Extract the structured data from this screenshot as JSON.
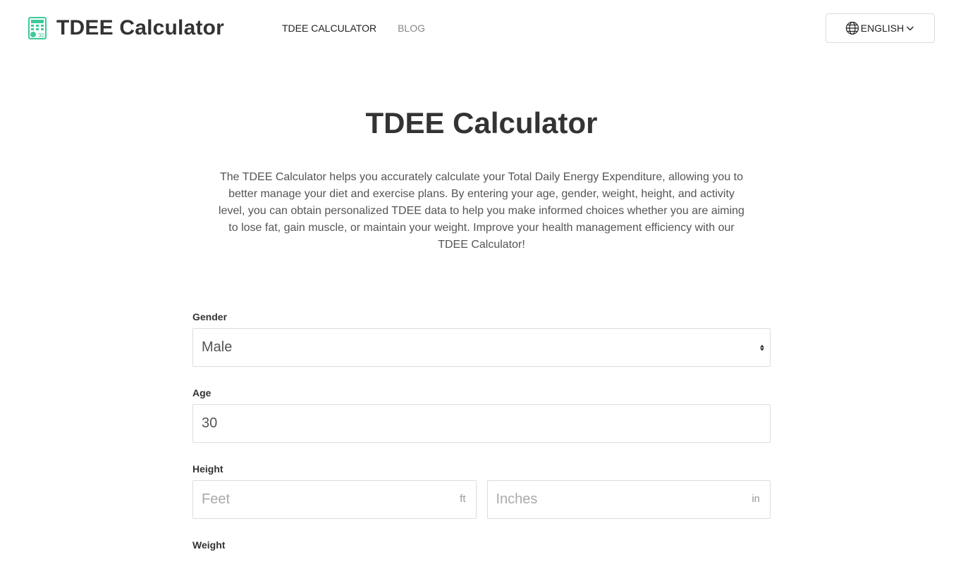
{
  "header": {
    "logo_text": "TDEE Calculator",
    "nav": [
      {
        "label": "TDEE CALCULATOR"
      },
      {
        "label": "BLOG"
      }
    ],
    "language": "ENGLISH"
  },
  "main": {
    "title": "TDEE Calculator",
    "intro": "The TDEE Calculator helps you accurately calculate your Total Daily Energy Expenditure, allowing you to better manage your diet and exercise plans. By entering your age, gender, weight, height, and activity level, you can obtain personalized TDEE data to help you make informed choices whether you are aiming to lose fat, gain muscle, or maintain your weight. Improve your health management efficiency with our TDEE Calculator!"
  },
  "form": {
    "gender": {
      "label": "Gender",
      "value": "Male"
    },
    "age": {
      "label": "Age",
      "value": "30"
    },
    "height": {
      "label": "Height",
      "feet_placeholder": "Feet",
      "feet_unit": "ft",
      "inches_placeholder": "Inches",
      "inches_unit": "in"
    },
    "weight": {
      "label": "Weight"
    }
  },
  "colors": {
    "logo_accent": "#3ec99a",
    "text": "#333333",
    "muted": "#888888",
    "border": "#dddddd"
  },
  "icons": [
    "calculator-logo-icon",
    "globe-icon",
    "chevron-down-icon",
    "select-arrows-icon"
  ]
}
